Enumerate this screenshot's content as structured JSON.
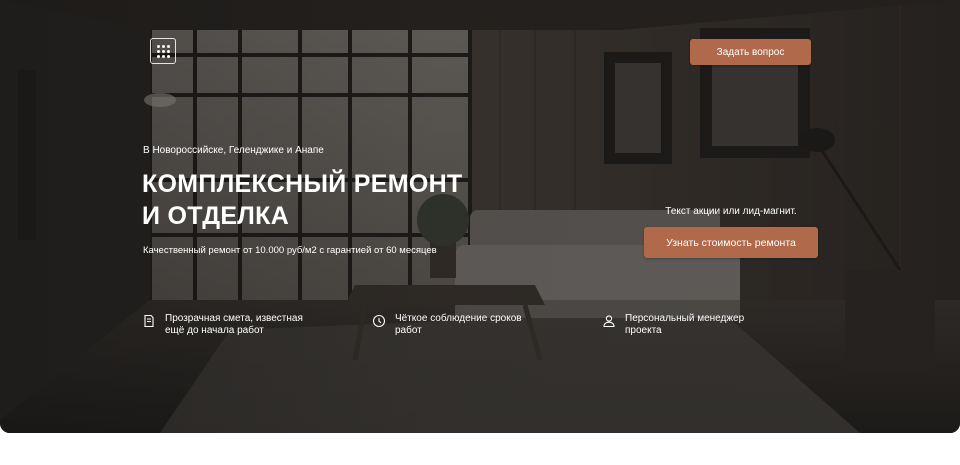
{
  "header": {
    "menu_icon": "grid-dots-icon",
    "ask_button_label": "Задать вопрос"
  },
  "hero": {
    "location": "В Новороссийске, Геленджике и Анапе",
    "title_line1": "КОМПЛЕКСНЫЙ РЕМОНТ",
    "title_line2": "И ОТДЕЛКА",
    "subtitle": "Качественный ремонт от 10.000 руб/м2 с гарантией от 60 месяцев",
    "promo_text": "Текст акции или лид-магнит.",
    "cost_button_label": "Узнать стоимость ремонта"
  },
  "features": [
    {
      "icon": "document-icon",
      "text": "Прозрачная смета, известная ещё до начала работ"
    },
    {
      "icon": "clock-icon",
      "text": "Чёткое соблюдение сроков работ"
    },
    {
      "icon": "person-icon",
      "text": "Персональный менеджер проекта"
    }
  ],
  "colors": {
    "accent": "#b0694a",
    "overlay": "#2f2c29",
    "text": "#ffffff"
  }
}
